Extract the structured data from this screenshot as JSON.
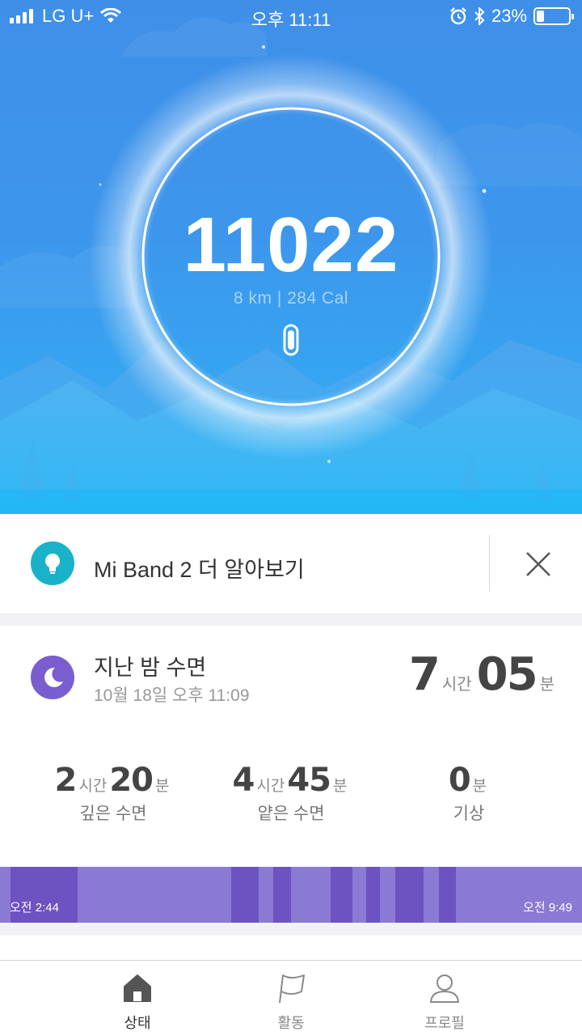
{
  "status_bar": {
    "carrier": "LG U+",
    "time": "오후 11:11",
    "battery_percent": "23%",
    "battery_level": 0.23,
    "icons": [
      "signal-icon",
      "wifi-icon",
      "alarm-icon",
      "bluetooth-icon",
      "battery-icon"
    ]
  },
  "activity": {
    "steps": "11022",
    "distance_calories": "8 km | 284 Cal",
    "device_icon": "band-icon"
  },
  "tip_card": {
    "text": "Mi Band 2 더 알아보기",
    "icon": "lightbulb-icon",
    "close_icon": "close-icon",
    "accent": "#19b2c9"
  },
  "sleep_card": {
    "title": "지난 밤 수면",
    "date": "10월 18일 오후 11:09",
    "icon": "moon-icon",
    "accent": "#7a5dcf",
    "total": {
      "hours": "7",
      "hours_unit": "시간",
      "minutes": "05",
      "minutes_unit": "분"
    },
    "deep": {
      "hours": "2",
      "hours_unit": "시간",
      "minutes": "20",
      "minutes_unit": "분",
      "label": "깊은 수면"
    },
    "light": {
      "hours": "4",
      "hours_unit": "시간",
      "minutes": "45",
      "minutes_unit": "분",
      "label": "얕은 수면"
    },
    "awake": {
      "minutes": "0",
      "minutes_unit": "분",
      "label": "기상"
    },
    "bar": {
      "start_time": "오전 2:44",
      "end_time": "오전 9:49",
      "deep_segments": [
        [
          0.018,
          0.133
        ],
        [
          0.397,
          0.444
        ],
        [
          0.469,
          0.499
        ],
        [
          0.568,
          0.606
        ],
        [
          0.629,
          0.653
        ],
        [
          0.679,
          0.728
        ],
        [
          0.754,
          0.783
        ]
      ]
    }
  },
  "tabs": [
    {
      "label": "상태",
      "icon": "home-icon",
      "active": true
    },
    {
      "label": "활동",
      "icon": "flag-icon",
      "active": false
    },
    {
      "label": "프로필",
      "icon": "profile-icon",
      "active": false
    }
  ]
}
